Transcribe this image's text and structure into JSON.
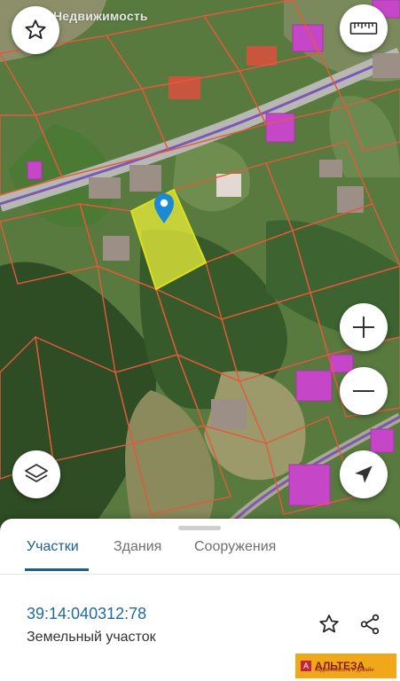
{
  "map": {
    "watermark": "Недвижимость",
    "parcel_color": "#ecf03a",
    "boundary_color": "#e4593d",
    "building_color": "#c547c8",
    "road_color": "#7b58b8"
  },
  "controls": {
    "favorite": "star-outline-icon",
    "ruler": "ruler-icon",
    "zoom_in": "plus-icon",
    "zoom_out": "minus-icon",
    "layers": "layers-icon",
    "locate": "navigation-arrow-icon"
  },
  "sheet": {
    "tabs": [
      {
        "label": "Участки",
        "active": true
      },
      {
        "label": "Здания",
        "active": false
      },
      {
        "label": "Сооружения",
        "active": false
      }
    ],
    "cadastral_number": "39:14:040312:78",
    "object_type": "Земельный участок"
  },
  "brand": {
    "name": "АЛЬТЕЗА",
    "tagline": "недвижимость и дизайн"
  }
}
